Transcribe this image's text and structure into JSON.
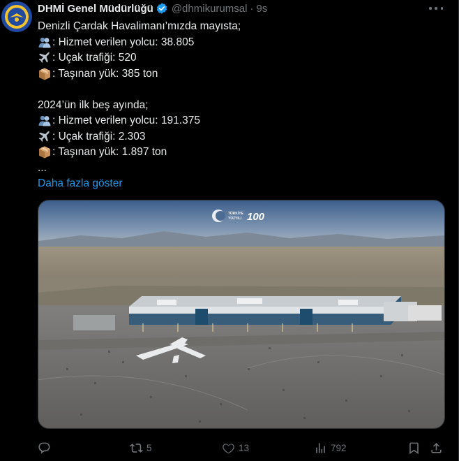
{
  "author": {
    "name": "DHMİ Genel Müdürlüğü",
    "handle": "@dhmikurumsal",
    "separator": "·",
    "time": "9s",
    "avatar_icon": "dhmi-emblem",
    "verified_icon": "verified-badge-icon"
  },
  "tweet": {
    "intro": "Denizli Çardak Havalimanı’mızda mayısta;",
    "may": [
      {
        "icon": "passenger-emoji",
        "text": ": Hizmet verilen yolcu: 38.805"
      },
      {
        "icon": "airplane-emoji",
        "text": ": Uçak trafiği: 520"
      },
      {
        "icon": "package-emoji",
        "text": ": Taşınan yük: 385 ton"
      }
    ],
    "second_intro": "2024’ün ilk beş ayında;",
    "ytd": [
      {
        "icon": "passenger-emoji",
        "text": ": Hizmet verilen yolcu: 191.375"
      },
      {
        "icon": "airplane-emoji",
        "text": ": Uçak trafiği: 2.303"
      },
      {
        "icon": "package-emoji",
        "text": ": Taşınan yük: 1.897 ton"
      }
    ],
    "ellipsis": "...",
    "show_more": "Daha fazla göster"
  },
  "media": {
    "logo_text_1": "TÜRKİYE",
    "logo_text_2": "YÜZYILI",
    "logo_100": "100"
  },
  "actions": {
    "reply_count": "",
    "retweet_count": "5",
    "like_count": "13",
    "views_count": "792"
  },
  "colors": {
    "background": "#000000",
    "text": "#e7e9ea",
    "muted": "#71767b",
    "link": "#1d9bf0",
    "verified": "#1d9bf0"
  }
}
